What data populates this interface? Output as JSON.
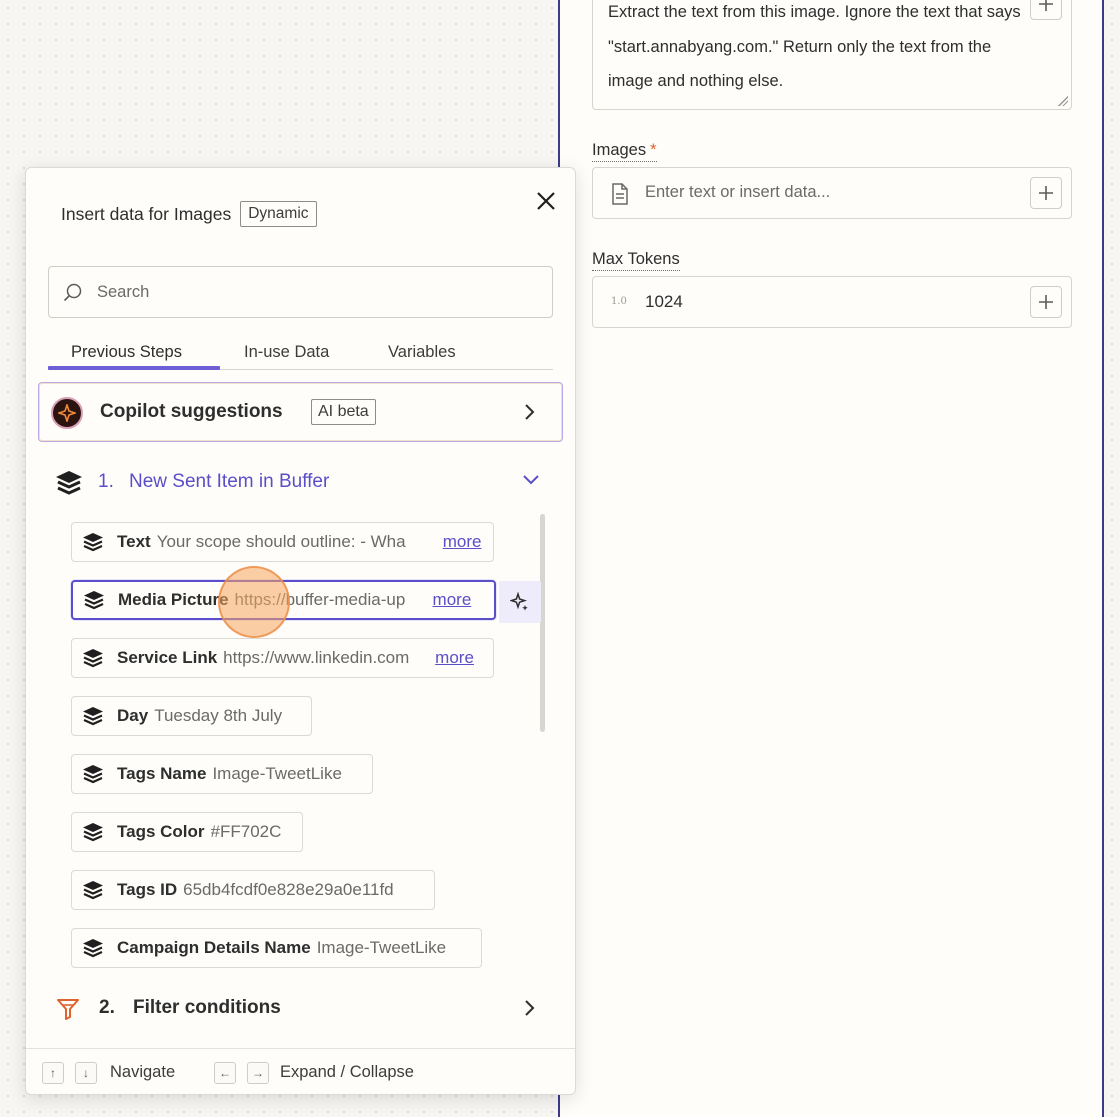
{
  "config": {
    "prompt_text": "Extract the text from this image. Ignore the text that says \"start.annabyang.com.\" Return only the text from the image and nothing else.",
    "images_label": "Images",
    "required_mark": "*",
    "images_placeholder": "Enter text or insert data...",
    "max_tokens_label": "Max Tokens",
    "max_tokens_icon_text": "1.0",
    "max_tokens_value": "1024"
  },
  "popover": {
    "title": "Insert data for Images",
    "badge": "Dynamic",
    "search_placeholder": "Search",
    "tabs": [
      "Previous Steps",
      "In-use Data",
      "Variables"
    ],
    "active_tab": "Previous Steps",
    "copilot": {
      "label": "Copilot suggestions",
      "badge": "AI beta"
    },
    "step1": {
      "number": "1.",
      "title": "New Sent Item in Buffer",
      "items": [
        {
          "key": "Text",
          "value": "Your scope should outline: - Wha",
          "more": "more"
        },
        {
          "key": "Media Picture",
          "value": "https://buffer-media-up",
          "more": "more"
        },
        {
          "key": "Service Link",
          "value": "https://www.linkedin.com",
          "more": "more"
        },
        {
          "key": "Day",
          "value": "Tuesday 8th July"
        },
        {
          "key": "Tags Name",
          "value": "Image-TweetLike"
        },
        {
          "key": "Tags Color",
          "value": "#FF702C"
        },
        {
          "key": "Tags ID",
          "value": "65db4fcdf0e828e29a0e11fd"
        },
        {
          "key": "Campaign Details Name",
          "value": "Image-TweetLike"
        }
      ]
    },
    "step2": {
      "number": "2.",
      "title": "Filter conditions"
    },
    "footer": {
      "up_key": "↑",
      "down_key": "↓",
      "navigate": "Navigate",
      "left_key": "←",
      "right_key": "→",
      "expand_collapse": "Expand / Collapse"
    }
  },
  "colors": {
    "accent": "#5a4ec9",
    "panel_border": "#3d3a8c",
    "required": "#e0632f",
    "filter_icon": "#e0632f"
  }
}
